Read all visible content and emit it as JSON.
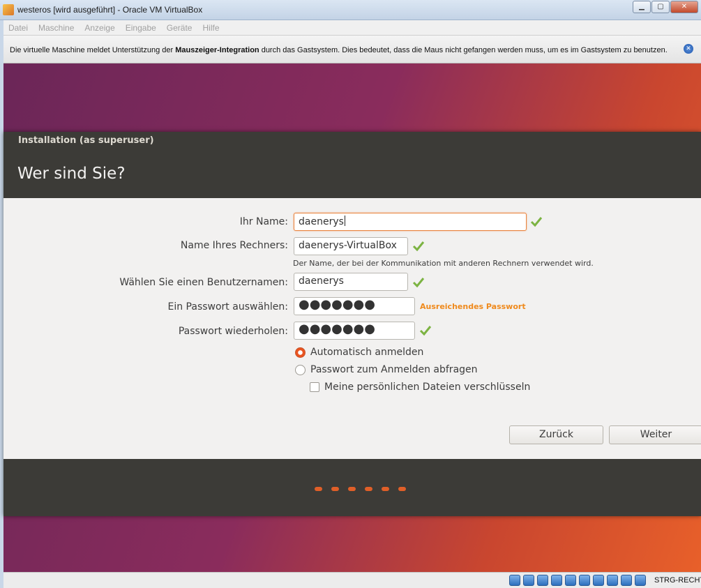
{
  "window": {
    "title": "westeros [wird ausgeführt] - Oracle VM VirtualBox",
    "min_label": "▁",
    "max_label": "▢",
    "close_label": "✕"
  },
  "menu": [
    "Datei",
    "Maschine",
    "Anzeige",
    "Eingabe",
    "Geräte",
    "Hilfe"
  ],
  "notice": {
    "prefix": "Die virtuelle Maschine meldet Unterstützung der ",
    "bold": "Mauszeiger-Integration",
    "suffix": " durch das Gastsystem. Dies bedeutet, dass die Maus nicht gefangen werden muss, um es im Gastsystem zu benutzen."
  },
  "installer": {
    "window_title": "Installation (as superuser)",
    "heading": "Wer sind Sie?",
    "name_label": "Ihr Name:",
    "name_value": "daenerys",
    "computer_label": "Name Ihres Rechners:",
    "computer_value": "daenerys-VirtualBox",
    "computer_hint": "Der Name, der bei der Kommunikation mit anderen Rechnern verwendet wird.",
    "username_label": "Wählen Sie einen Benutzernamen:",
    "username_value": "daenerys",
    "password_label": "Ein Passwort auswählen:",
    "password_value": "●●●●●●●",
    "password_strength": "Ausreichendes Passwort",
    "confirm_label": "Passwort wiederholen:",
    "confirm_value": "●●●●●●●",
    "auto_login_label": "Automatisch anmelden",
    "require_password_label": "Passwort zum Anmelden abfragen",
    "encrypt_label": "Meine persönlichen Dateien verschlüsseln",
    "auto_login_selected": true,
    "encrypt_checked": false,
    "back_button": "Zurück",
    "next_button": "Weiter",
    "progress_steps": 6
  },
  "statusbar": {
    "host_key": "STRG-RECHTS"
  },
  "colors": {
    "accent": "#e95420",
    "valid_check": "#7cb342",
    "strength": "#ef8a1d",
    "header_bg": "#3c3b37"
  }
}
